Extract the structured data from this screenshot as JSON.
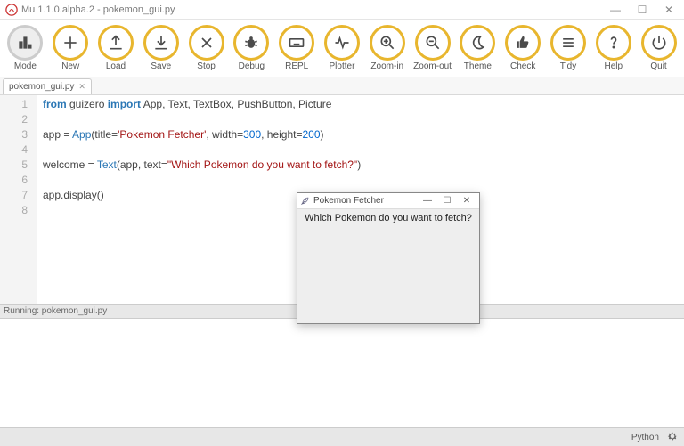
{
  "window": {
    "title": "Mu 1.1.0.alpha.2 - pokemon_gui.py",
    "minimize": "—",
    "maximize": "☐",
    "close": "✕"
  },
  "toolbar": [
    {
      "id": "mode",
      "label": "Mode"
    },
    {
      "id": "new",
      "label": "New"
    },
    {
      "id": "load",
      "label": "Load"
    },
    {
      "id": "save",
      "label": "Save"
    },
    {
      "id": "stop",
      "label": "Stop"
    },
    {
      "id": "debug",
      "label": "Debug"
    },
    {
      "id": "repl",
      "label": "REPL"
    },
    {
      "id": "plotter",
      "label": "Plotter"
    },
    {
      "id": "zoom-in",
      "label": "Zoom-in"
    },
    {
      "id": "zoom-out",
      "label": "Zoom-out"
    },
    {
      "id": "theme",
      "label": "Theme"
    },
    {
      "id": "check",
      "label": "Check"
    },
    {
      "id": "tidy",
      "label": "Tidy"
    },
    {
      "id": "help",
      "label": "Help"
    },
    {
      "id": "quit",
      "label": "Quit"
    }
  ],
  "tab": {
    "name": "pokemon_gui.py",
    "close": "✕"
  },
  "gutter": [
    "1",
    "2",
    "3",
    "4",
    "5",
    "6",
    "7",
    "8"
  ],
  "code": {
    "l1a": "from",
    "l1b": " guizero ",
    "l1c": "import",
    "l1d": " App, Text, TextBox, PushButton, Picture",
    "l3a": "app = ",
    "l3b": "App",
    "l3c": "(title=",
    "l3d": "'Pokemon Fetcher'",
    "l3e": ", width=",
    "l3f": "300",
    "l3g": ", height=",
    "l3h": "200",
    "l3i": ")",
    "l5a": "welcome = ",
    "l5b": "Text",
    "l5c": "(app, text=",
    "l5d": "\"Which Pokemon do you want to fetch?\"",
    "l5e": ")",
    "l7a": "app.display()"
  },
  "status": {
    "running": "Running: pokemon_gui.py"
  },
  "footer": {
    "lang": "Python"
  },
  "popup": {
    "title": "Pokemon Fetcher",
    "body": "Which Pokemon do you want to fetch?",
    "minimize": "—",
    "maximize": "☐",
    "close": "✕"
  }
}
